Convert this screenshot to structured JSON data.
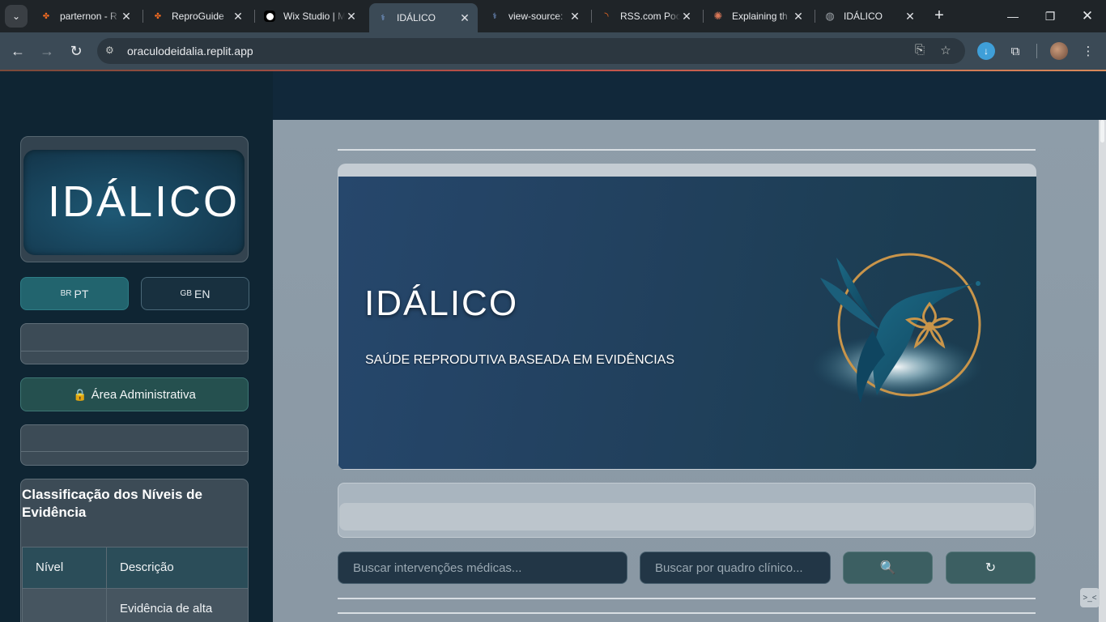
{
  "browser": {
    "tabs": [
      {
        "title": "parternon - R",
        "favicon_color": "#f26b21"
      },
      {
        "title": "ReproGuide",
        "favicon_color": "#f26b21"
      },
      {
        "title": "Wix Studio | M",
        "favicon_color": "#ffffff"
      },
      {
        "title": "IDÁLICO",
        "favicon_color": "#8ab4f8"
      },
      {
        "title": "view-source:",
        "favicon_color": "#8ab4f8"
      },
      {
        "title": "RSS.com Poc",
        "favicon_color": "#f26b21"
      },
      {
        "title": "Explaining th",
        "favicon_color": "#d97757"
      },
      {
        "title": "IDÁLICO",
        "favicon_color": "#9aa0a6"
      }
    ],
    "active_tab_index": 3,
    "url": "oraculodeidalia.replit.app",
    "icons": {
      "tab_menu": "chevron-down-icon",
      "close": "close-icon",
      "new_tab": "plus-icon",
      "back": "arrow-left-icon",
      "forward": "arrow-right-icon",
      "reload": "reload-icon",
      "site_info": "tune-icon",
      "translate": "translate-icon",
      "bookmark": "star-icon",
      "download": "download-icon",
      "extensions": "puzzle-icon",
      "menu": "kebab-icon"
    }
  },
  "sidebar": {
    "logo_text": "IDÁLICO",
    "lang_pt": {
      "flag": "BR",
      "label": "PT"
    },
    "lang_en": {
      "flag": "GB",
      "label": "EN"
    },
    "admin_button": {
      "icon": "lock-icon",
      "label": "Área Administrativa"
    },
    "evidence": {
      "title": "Classificação dos Níveis de Evidência",
      "headers": [
        "Nível",
        "Descrição"
      ],
      "rows": [
        {
          "level": "",
          "description": "Evidência de alta"
        }
      ]
    }
  },
  "hero": {
    "title": "IDÁLICO",
    "subtitle": "SAÚDE REPRODUTIVA BASEADA EM EVIDÊNCIAS"
  },
  "search": {
    "interventions_placeholder": "Buscar intervenções médicas...",
    "clinical_placeholder": "Buscar por quadro clínico...",
    "search_button": "🔍",
    "reset_button": "↻"
  },
  "colors": {
    "sidebar_bg": "#0f2533",
    "main_bg": "#8d9ca8",
    "accent_teal": "#22646e",
    "admin_green": "#25504f",
    "gold": "#c9954a"
  }
}
